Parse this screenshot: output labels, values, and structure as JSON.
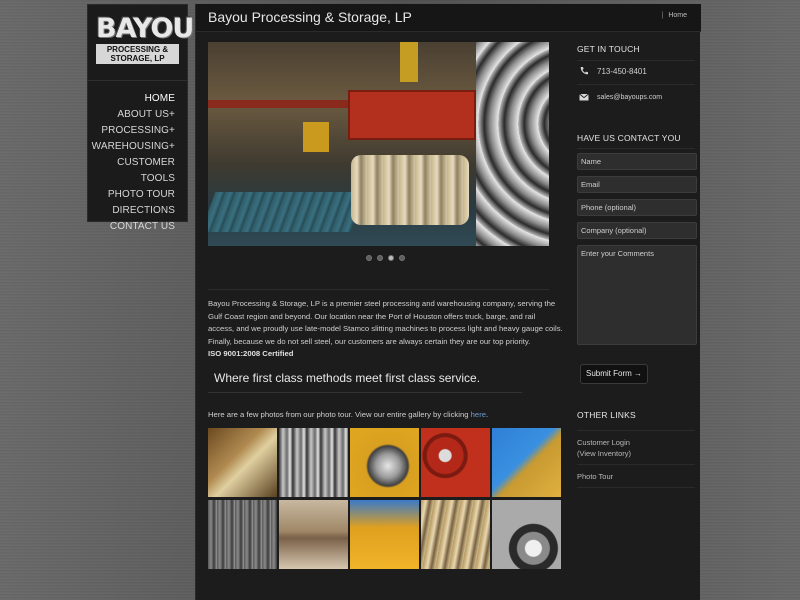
{
  "logo": {
    "big": "BAYOU",
    "sub_line1": "PROCESSING &",
    "sub_line2": "STORAGE, LP"
  },
  "nav": {
    "items": [
      {
        "label": "HOME",
        "active": true
      },
      {
        "label": "ABOUT US+"
      },
      {
        "label": "PROCESSING+"
      },
      {
        "label": "WAREHOUSING+"
      },
      {
        "label": "CUSTOMER TOOLS"
      },
      {
        "label": "PHOTO TOUR"
      },
      {
        "label": "DIRECTIONS"
      },
      {
        "label": "CONTACT US"
      }
    ]
  },
  "header": {
    "title": "Bayou Processing & Storage, LP",
    "breadcrumb_sep": "|",
    "breadcrumb": "Home"
  },
  "slider": {
    "dots": 4,
    "active_dot": 3
  },
  "main": {
    "intro": "Bayou Processing & Storage, LP is a premier steel processing and warehousing company, serving the Gulf Coast region and beyond. Our location near the Port of Houston offers truck, barge, and rail access, and we proudly use late-model Stamco slitting machines to process light and heavy gauge coils. Finally, because we do not sell steel, our customers are always certain they are our top priority.",
    "cert": "ISO 9001:2008 Certified",
    "tagline": "Where first class methods meet first class service.",
    "photo_intro": "Here are a few photos from our photo tour. View our entire gallery by clicking",
    "photo_link": "here",
    "photo_end": "."
  },
  "sidebar": {
    "get_in_touch": "GET IN TOUCH",
    "phone": "713-450-8401",
    "email": "sales@bayoups.com",
    "contact_heading": "HAVE US CONTACT YOU",
    "fields": {
      "name": "Name",
      "email": "Email",
      "phone": "Phone (optional)",
      "company": "Company (optional)",
      "comments": "Enter your Comments"
    },
    "submit": "Submit Form →",
    "other_links_heading": "OTHER LINKS",
    "links": {
      "customer_login_1": "Customer Login",
      "customer_login_2": "(View Inventory)",
      "photo_tour": "Photo Tour"
    }
  },
  "colors": {
    "panel": "#1c1c1c",
    "nav": "#1b1b1b",
    "link": "#6e9ad1"
  }
}
